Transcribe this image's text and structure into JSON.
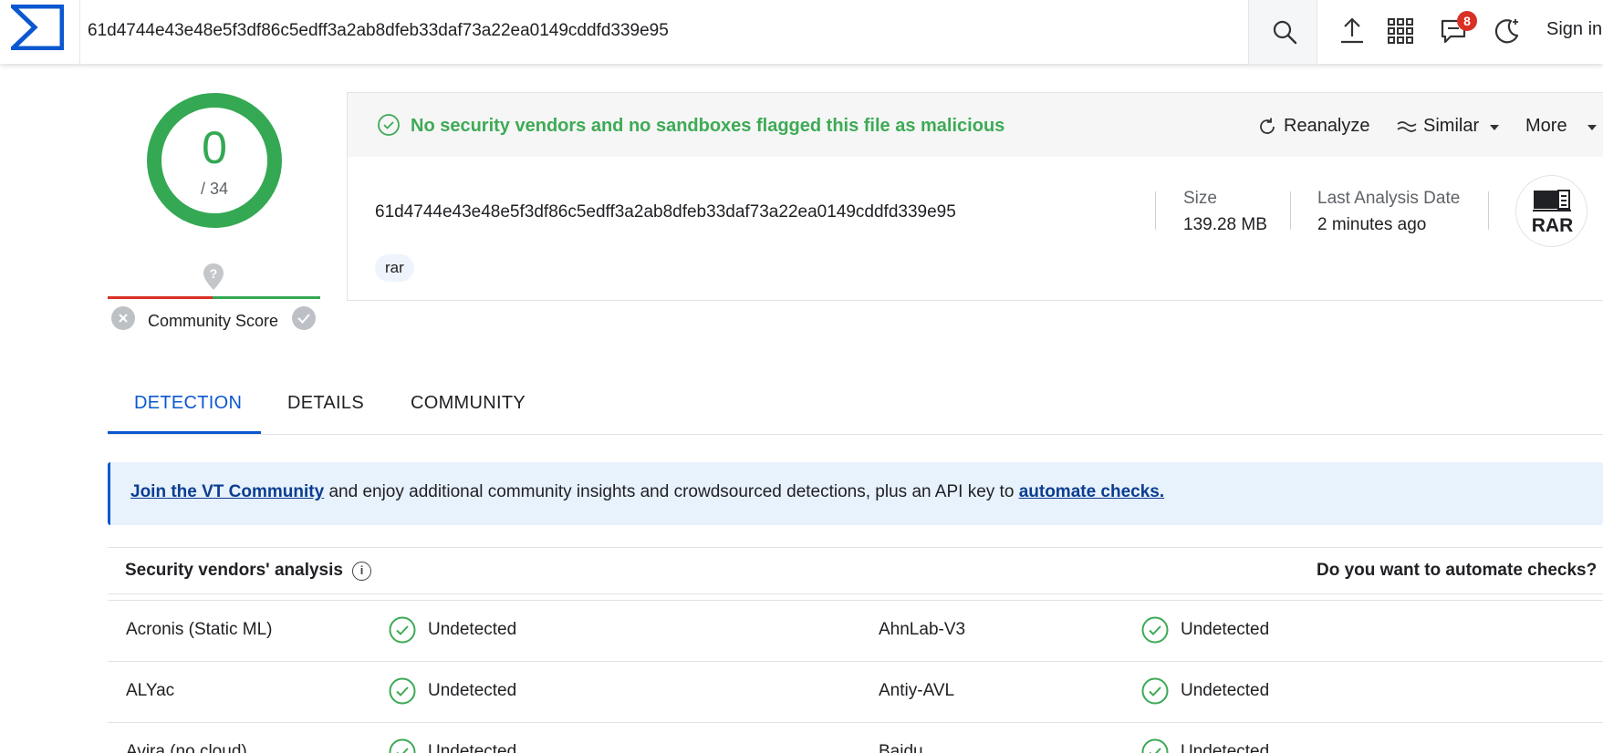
{
  "topbar": {
    "search_value": "61d4744e43e48e5f3df86c5edff3a2ab8dfeb33daf73a22ea0149cddfd339e95",
    "notification_count": "8",
    "signin_label": "Sign in"
  },
  "score": {
    "detections": "0",
    "total": "/ 34",
    "community_label": "Community Score"
  },
  "summary": {
    "verdict": "No security vendors and no sandboxes flagged this file as malicious",
    "reanalyze_label": "Reanalyze",
    "similar_label": "Similar",
    "more_label": "More",
    "file_hash": "61d4744e43e48e5f3df86c5edff3a2ab8dfeb33daf73a22ea0149cddfd339e95",
    "tag": "rar",
    "size_label": "Size",
    "size_value": "139.28 MB",
    "last_analysis_label": "Last Analysis Date",
    "last_analysis_value": "2 minutes ago",
    "file_type": "RAR"
  },
  "tabs": [
    {
      "label": "DETECTION"
    },
    {
      "label": "DETAILS"
    },
    {
      "label": "COMMUNITY"
    }
  ],
  "banner": {
    "join_link": "Join the VT Community",
    "text": " and enjoy additional community insights and crowdsourced detections, plus an API key to ",
    "automate_link": "automate checks."
  },
  "vendors": {
    "title": "Security vendors' analysis",
    "automate_prompt": "Do you want to automate checks?",
    "rows": [
      {
        "left_vendor": "Acronis (Static ML)",
        "left_status": "Undetected",
        "right_vendor": "AhnLab-V3",
        "right_status": "Undetected"
      },
      {
        "left_vendor": "ALYac",
        "left_status": "Undetected",
        "right_vendor": "Antiy-AVL",
        "right_status": "Undetected"
      },
      {
        "left_vendor": "Avira (no cloud)",
        "left_status": "Undetected",
        "right_vendor": "Baidu",
        "right_status": "Undetected"
      }
    ]
  },
  "colors": {
    "accent": "#0b57d0",
    "clean_green": "#34a853",
    "malicious_red": "#d93025"
  }
}
